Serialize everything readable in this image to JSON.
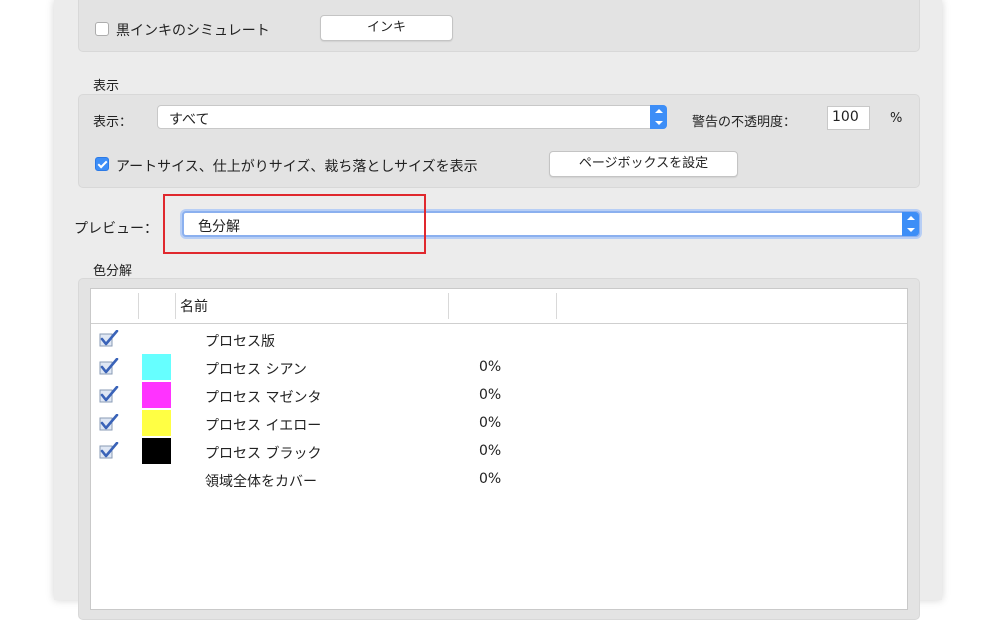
{
  "ink_section": {
    "simulate_black_label": "黒インキのシミュレート",
    "simulate_black_checked": false,
    "inks_button": "インキ"
  },
  "display_section": {
    "heading": "表示",
    "display_label": "表示：",
    "display_value": "すべて",
    "warning_opacity_label": "警告の不透明度：",
    "warning_opacity_value": "100",
    "percent_sign": "%",
    "show_sizes_label": "アートサイス、仕上がりサイズ、裁ち落としサイズを表示",
    "show_sizes_checked": true,
    "page_box_button": "ページボックスを設定"
  },
  "preview": {
    "label": "プレビュー：",
    "value": "色分解"
  },
  "separations": {
    "heading": "色分解",
    "name_header": "名前",
    "rows": [
      {
        "name": "プロセス版",
        "percent": "",
        "checked": true,
        "swatch": null
      },
      {
        "name": "プロセス シアン",
        "percent": "0%",
        "checked": true,
        "swatch": "#66ffff"
      },
      {
        "name": "プロセス マゼンタ",
        "percent": "0%",
        "checked": true,
        "swatch": "#ff33ff"
      },
      {
        "name": "プロセス イエロー",
        "percent": "0%",
        "checked": true,
        "swatch": "#ffff44"
      },
      {
        "name": "プロセス ブラック",
        "percent": "0%",
        "checked": true,
        "swatch": "#000000"
      },
      {
        "name": "領域全体をカバー",
        "percent": "0%",
        "checked": false,
        "swatch": null
      }
    ]
  },
  "colors": {
    "accent": "#3d8ef7",
    "highlight_red": "#e0282e"
  }
}
